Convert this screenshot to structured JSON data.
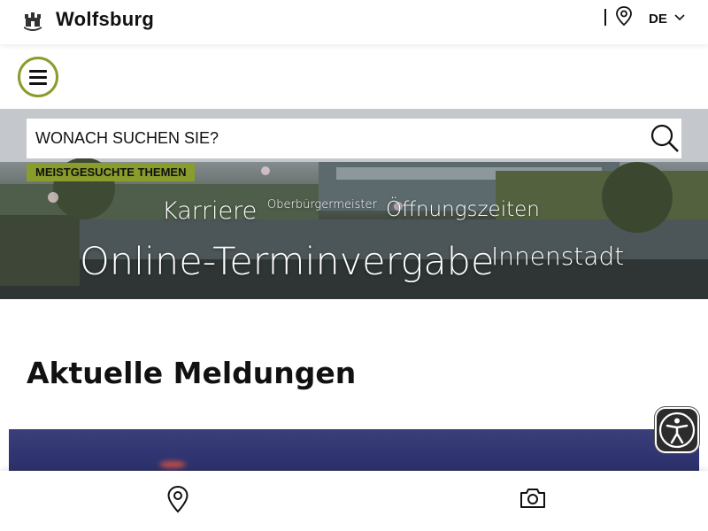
{
  "header": {
    "brand": "Wolfsburg",
    "language": "DE",
    "icons": [
      "crest-logo-icon",
      "location-pin-icon",
      "chevron-down-icon"
    ]
  },
  "menu": {
    "icon": "hamburger-menu-icon"
  },
  "search": {
    "placeholder": "WONACH SUCHEN SIE?",
    "icon": "search-icon",
    "tag_label": "MEISTGESUCHTE THEMEN"
  },
  "topics": [
    "Karriere",
    "Oberbürgermeister",
    "Öffnungszeiten",
    "Online-Terminvergabe",
    "Innenstadt"
  ],
  "main": {
    "section_title": "Aktuelle Meldungen"
  },
  "accessibility": {
    "icon": "accessibility-icon"
  },
  "bottom_bar": {
    "icons": [
      "location-pin-icon",
      "camera-icon"
    ]
  },
  "colors": {
    "accent": "#8a9c2c",
    "text": "#111111",
    "hero_dark": "#2e3434"
  }
}
